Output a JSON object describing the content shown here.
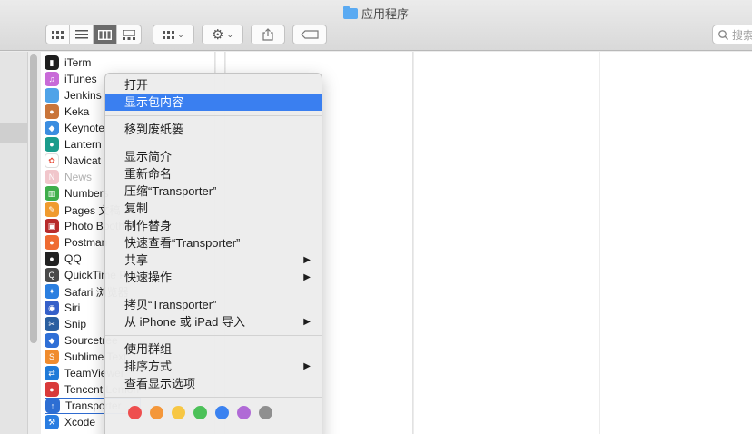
{
  "window": {
    "title": "应用程序"
  },
  "toolbar": {
    "view_icons": [
      "icon-view-icon",
      "list-view-icon",
      "column-view-icon",
      "gallery-view-icon"
    ],
    "group_icon": "grid-group-icon",
    "action_icon": "gear-icon",
    "share_icon": "share-icon",
    "tag_icon": "tag-icon",
    "search_placeholder": "搜索"
  },
  "files": [
    {
      "name": "iTerm",
      "color": "#1e1e1e",
      "glyph": "▮"
    },
    {
      "name": "iTunes",
      "color": "#c86ad8",
      "glyph": "♫"
    },
    {
      "name": "Jenkins",
      "color": "#4fa3e8",
      "glyph": ""
    },
    {
      "name": "Keka",
      "color": "#c9753a",
      "glyph": "●"
    },
    {
      "name": "Keynote",
      "color": "#3b8de0",
      "glyph": "◆"
    },
    {
      "name": "Lantern",
      "color": "#1a9c8c",
      "glyph": "●"
    },
    {
      "name": "Navicat",
      "color": "#ffffff",
      "glyph": "✿",
      "glyph_color": "#e84e3c"
    },
    {
      "name": "News",
      "color": "#f1c6cb",
      "glyph": "N",
      "dim": true
    },
    {
      "name": "Numbers",
      "color": "#3fae4b",
      "glyph": "▥"
    },
    {
      "name": "Pages 文稿",
      "color": "#f09b2e",
      "glyph": "✎"
    },
    {
      "name": "Photo Booth",
      "color": "#b82b2b",
      "glyph": "▣"
    },
    {
      "name": "Postman",
      "color": "#ef6b32",
      "glyph": "●"
    },
    {
      "name": "QQ",
      "color": "#222222",
      "glyph": "●"
    },
    {
      "name": "QuickTime Player",
      "color": "#4a4a4a",
      "glyph": "Q"
    },
    {
      "name": "Safari 浏览器",
      "color": "#2b7fe0",
      "glyph": "✦"
    },
    {
      "name": "Siri",
      "color": "#3560c9",
      "glyph": "◉"
    },
    {
      "name": "Snip",
      "color": "#2a5fa0",
      "glyph": "✂"
    },
    {
      "name": "Sourcetree",
      "color": "#2f6fd6",
      "glyph": "◆"
    },
    {
      "name": "Sublime Text",
      "color": "#f08c2e",
      "glyph": "S"
    },
    {
      "name": "TeamViewer",
      "color": "#1f7ad8",
      "glyph": "⇄"
    },
    {
      "name": "Tencent Lemon",
      "color": "#d93a3a",
      "glyph": "●"
    },
    {
      "name": "Transporter",
      "color": "#2d6ed3",
      "glyph": "↑",
      "selected": true
    },
    {
      "name": "Xcode",
      "color": "#2a7de1",
      "glyph": "⚒"
    }
  ],
  "menu": {
    "groups": [
      [
        {
          "label": "打开"
        },
        {
          "label": "显示包内容",
          "highlighted": true
        }
      ],
      [
        {
          "label": "移到废纸篓"
        }
      ],
      [
        {
          "label": "显示简介"
        },
        {
          "label": "重新命名"
        },
        {
          "label": "压缩“Transporter”"
        },
        {
          "label": "复制"
        },
        {
          "label": "制作替身"
        },
        {
          "label": "快速查看“Transporter”"
        },
        {
          "label": "共享",
          "submenu": true
        },
        {
          "label": "快速操作",
          "submenu": true
        }
      ],
      [
        {
          "label": "拷贝“Transporter”"
        },
        {
          "label": "从 iPhone 或 iPad 导入",
          "submenu": true
        }
      ],
      [
        {
          "label": "使用群组"
        },
        {
          "label": "排序方式",
          "submenu": true
        },
        {
          "label": "查看显示选项"
        }
      ]
    ],
    "tag_colors": [
      "#ee4f4f",
      "#f4973a",
      "#f7c744",
      "#4cc159",
      "#3b82f0",
      "#b06ad6",
      "#8f8f8f"
    ]
  }
}
